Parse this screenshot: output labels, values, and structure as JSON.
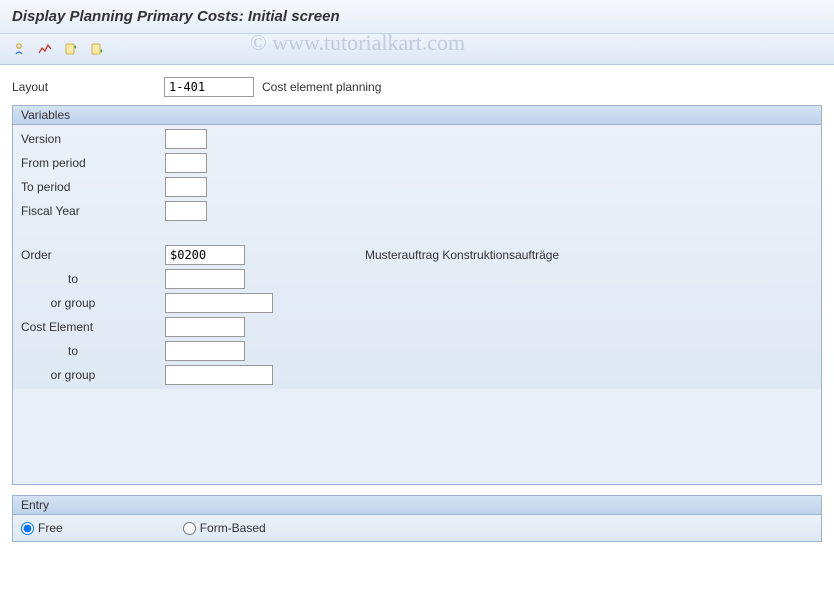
{
  "title": "Display Planning Primary Costs: Initial screen",
  "watermark": "© www.tutorialkart.com",
  "layout": {
    "label": "Layout",
    "value": "1-401",
    "description": "Cost element planning"
  },
  "panels": {
    "variables": {
      "title": "Variables",
      "fields": {
        "version": {
          "label": "Version",
          "value": ""
        },
        "from_period": {
          "label": "From period",
          "value": ""
        },
        "to_period": {
          "label": "To period",
          "value": ""
        },
        "fiscal_year": {
          "label": "Fiscal Year",
          "value": ""
        },
        "order": {
          "label": "Order",
          "value": "$0200",
          "description": "Musterauftrag Konstruktionsaufträge"
        },
        "order_to": {
          "label": "to",
          "value": ""
        },
        "order_group": {
          "label": "or group",
          "value": ""
        },
        "cost_element": {
          "label": "Cost Element",
          "value": ""
        },
        "cost_element_to": {
          "label": "to",
          "value": ""
        },
        "cost_element_group": {
          "label": "or group",
          "value": ""
        }
      }
    },
    "entry": {
      "title": "Entry",
      "options": {
        "free": "Free",
        "form": "Form-Based"
      }
    }
  }
}
